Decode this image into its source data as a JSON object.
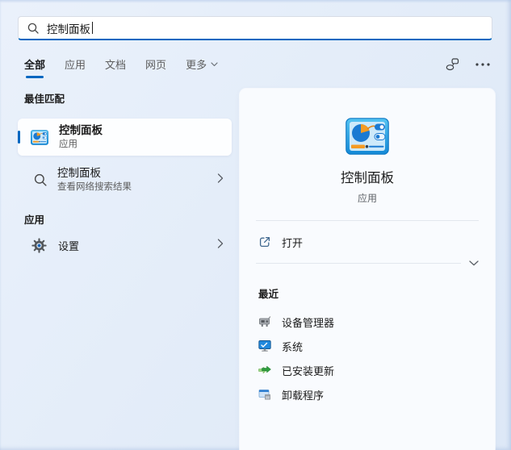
{
  "colors": {
    "accent": "#0067c0",
    "left_bg": "#e4edf9",
    "panel_bg": "#f9fbfe"
  },
  "search": {
    "value": "控制面板",
    "icon": "search-icon"
  },
  "tabs": {
    "all": "全部",
    "apps": "应用",
    "docs": "文档",
    "web": "网页",
    "more": "更多",
    "active": "全部"
  },
  "top_actions": {
    "account_icon": "contact-bubble-icon",
    "more_icon": "ellipsis-icon"
  },
  "left": {
    "best_match_header": "最佳匹配",
    "best_match": {
      "title": "控制面板",
      "subtitle": "应用",
      "icon": "control-panel-icon"
    },
    "web_result": {
      "title": "控制面板",
      "subtitle": "查看网络搜索结果",
      "icon": "search-icon",
      "chevron": "chevron-right-icon"
    },
    "apps_header": "应用",
    "settings_item": {
      "label": "设置",
      "icon": "settings-gear-icon",
      "chevron": "chevron-right-icon"
    }
  },
  "preview": {
    "icon": "control-panel-icon",
    "app_title": "控制面板",
    "app_subtitle": "应用",
    "open_label": "打开",
    "open_icon": "open-external-icon",
    "collapse_icon": "chevron-down-icon",
    "recent_header": "最近",
    "recent": [
      {
        "label": "设备管理器",
        "icon": "device-manager-icon"
      },
      {
        "label": "系统",
        "icon": "system-monitor-icon"
      },
      {
        "label": "已安装更新",
        "icon": "installed-updates-icon"
      },
      {
        "label": "卸载程序",
        "icon": "uninstall-program-icon"
      }
    ]
  }
}
